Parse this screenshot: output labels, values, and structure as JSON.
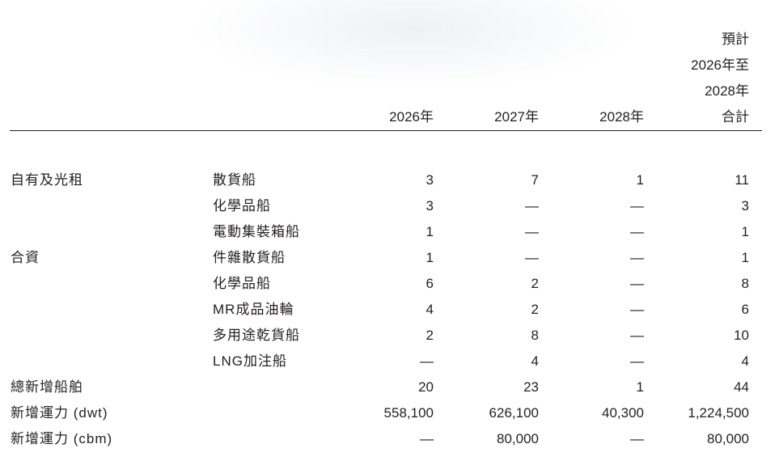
{
  "header": {
    "total_line1": "預計",
    "total_line2": "2026年至",
    "total_line3": "2028年",
    "total_line4": "合計",
    "col_2026": "2026年",
    "col_2027": "2027年",
    "col_2028": "2028年"
  },
  "rows": [
    {
      "label": "自有及光租",
      "sub": "散貨船",
      "v2026": "3",
      "v2027": "7",
      "v2028": "1",
      "total": "11"
    },
    {
      "label": "",
      "sub": "化學品船",
      "v2026": "3",
      "v2027": "—",
      "v2028": "—",
      "total": "3"
    },
    {
      "label": "",
      "sub": "電動集裝箱船",
      "v2026": "1",
      "v2027": "—",
      "v2028": "—",
      "total": "1"
    },
    {
      "label": "合資",
      "sub": "件雜散貨船",
      "v2026": "1",
      "v2027": "—",
      "v2028": "—",
      "total": "1"
    },
    {
      "label": "",
      "sub": "化學品船",
      "v2026": "6",
      "v2027": "2",
      "v2028": "—",
      "total": "8"
    },
    {
      "label": "",
      "sub": "MR成品油輪",
      "v2026": "4",
      "v2027": "2",
      "v2028": "—",
      "total": "6"
    },
    {
      "label": "",
      "sub": "多用途乾貨船",
      "v2026": "2",
      "v2027": "8",
      "v2028": "—",
      "total": "10"
    },
    {
      "label": "",
      "sub": "LNG加注船",
      "v2026": "—",
      "v2027": "4",
      "v2028": "—",
      "total": "4"
    },
    {
      "label": "總新增船舶",
      "sub": "",
      "v2026": "20",
      "v2027": "23",
      "v2028": "1",
      "total": "44"
    },
    {
      "label": "新增運力 (dwt)",
      "sub": "",
      "v2026": "558,100",
      "v2027": "626,100",
      "v2028": "40,300",
      "total": "1,224,500"
    },
    {
      "label": "新增運力 (cbm)",
      "sub": "",
      "v2026": "—",
      "v2027": "80,000",
      "v2028": "—",
      "total": "80,000"
    }
  ]
}
